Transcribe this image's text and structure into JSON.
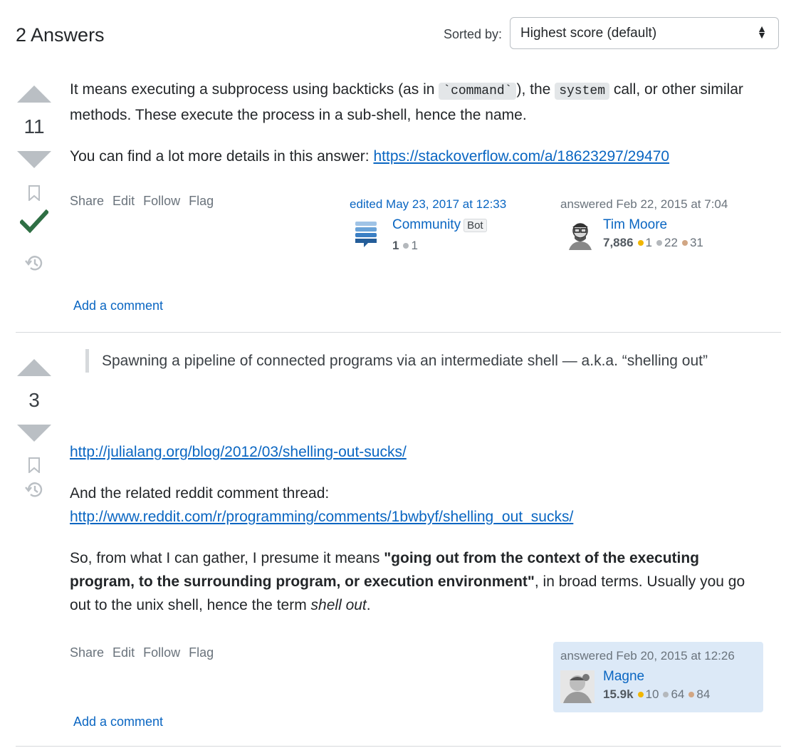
{
  "header": {
    "title": "2 Answers",
    "sort_label": "Sorted by:",
    "sort_value": "Highest score (default)"
  },
  "answers": [
    {
      "score": "11",
      "accepted": true,
      "body": {
        "p1_a": "It means executing a subprocess using backticks (as in ",
        "code1": "`command`",
        "p1_b": "), the ",
        "code2": "system",
        "p1_c": " call, or other similar methods. These execute the process in a sub-shell, hence the name.",
        "p2_a": "You can find a lot more details in this answer: ",
        "p2_link": "https://stackoverflow.com/a/18623297/29470"
      },
      "menu": [
        "Share",
        "Edit",
        "Follow",
        "Flag"
      ],
      "editor": {
        "action": "edited May 23, 2017 at 12:33",
        "name": "Community",
        "tag": "Bot",
        "rep": "1",
        "silver": "1"
      },
      "author": {
        "action": "answered Feb 22, 2015 at 7:04",
        "name": "Tim Moore",
        "rep": "7,886",
        "gold": "1",
        "silver": "22",
        "bronze": "31"
      },
      "add_comment": "Add a comment"
    },
    {
      "score": "3",
      "accepted": false,
      "quote": "Spawning a pipeline of connected programs via an intermediate shell — a.k.a. “shelling out”",
      "body": {
        "link1": "http://julialang.org/blog/2012/03/shelling-out-sucks/",
        "p2": "And the related reddit comment thread:",
        "link2": "http://www.reddit.com/r/programming/comments/1bwbyf/shelling_out_sucks/",
        "p3_a": "So, from what I can gather, I presume it means ",
        "p3_bold": "\"going out from the context of the executing program, to the surrounding program, or execution environment\"",
        "p3_b": ", in broad terms. Usually you go out to the unix shell, hence the term ",
        "p3_em": "shell out",
        "p3_c": "."
      },
      "menu": [
        "Share",
        "Edit",
        "Follow",
        "Flag"
      ],
      "author": {
        "action": "answered Feb 20, 2015 at 12:26",
        "name": "Magne",
        "rep": "15.9k",
        "gold": "10",
        "silver": "64",
        "bronze": "84"
      },
      "add_comment": "Add a comment"
    }
  ],
  "colors": {
    "link": "#0a66c2",
    "accepted": "#2f6f44",
    "vote_arrow": "#babfc4",
    "owner_highlight": "#dce9f7"
  }
}
